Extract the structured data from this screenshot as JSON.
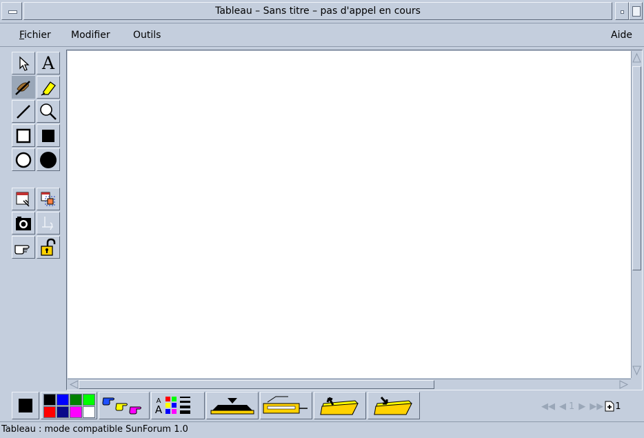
{
  "window": {
    "title": "Tableau – Sans titre  – pas d'appel en cours"
  },
  "menubar": {
    "items": [
      {
        "mnemonic": "F",
        "rest": "ichier"
      },
      {
        "label": "Modifier"
      },
      {
        "label": "Outils"
      },
      {
        "label": "Aide"
      }
    ]
  },
  "tools": [
    {
      "name": "select-pointer-icon"
    },
    {
      "name": "text-tool-icon",
      "glyph": "A"
    },
    {
      "name": "pen-tool-icon",
      "selected": true
    },
    {
      "name": "highlighter-icon"
    },
    {
      "name": "line-tool-icon"
    },
    {
      "name": "magnifier-icon"
    },
    {
      "name": "rectangle-outline-icon"
    },
    {
      "name": "rectangle-filled-icon"
    },
    {
      "name": "ellipse-outline-icon"
    },
    {
      "name": "ellipse-filled-icon"
    },
    {
      "name": "window-grab-icon"
    },
    {
      "name": "region-grab-icon"
    },
    {
      "name": "camera-icon"
    },
    {
      "name": "crop-disabled-icon"
    },
    {
      "name": "pointing-hand-icon"
    },
    {
      "name": "lock-icon"
    }
  ],
  "colors": {
    "palette": [
      "#000000",
      "#0000ff",
      "#008000",
      "#00ff00",
      "#ff0000",
      "#0a0a8a",
      "#ff00ff",
      "#ffffff"
    ],
    "current": "#000000",
    "accent_yellow": "#ffff00"
  },
  "bottom_toolbar": {
    "font_size_glyph_top": "A",
    "font_size_glyph_bottom": "A",
    "page_number": "1",
    "page_count": "1"
  },
  "status": {
    "text": "Tableau : mode compatible SunForum 1.0"
  }
}
